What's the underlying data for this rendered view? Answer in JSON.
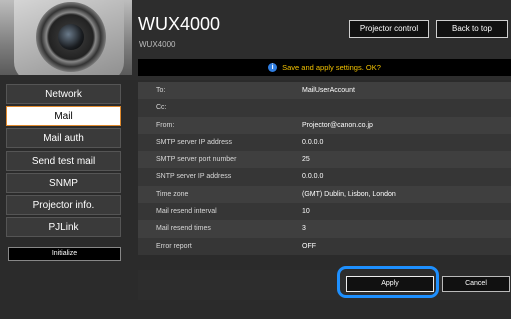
{
  "header": {
    "title": "WUX4000",
    "subtitle": "WUX4000",
    "projector_control_label": "Projector control",
    "back_to_top_label": "Back to top",
    "message": "Save and apply settings. OK?"
  },
  "sidebar": {
    "items": [
      {
        "label": "Network"
      },
      {
        "label": "Mail"
      },
      {
        "label": "Mail auth"
      },
      {
        "label": "Send test mail"
      },
      {
        "label": "SNMP"
      },
      {
        "label": "Projector info."
      },
      {
        "label": "PJLink"
      }
    ],
    "active": "Mail",
    "initialize_label": "Initialize"
  },
  "settings": {
    "rows": [
      {
        "label": "To:",
        "value": "MailUserAccount"
      },
      {
        "label": "Cc:",
        "value": ""
      },
      {
        "label": "From:",
        "value": "Projector@canon.co.jp"
      },
      {
        "label": "SMTP server IP address",
        "value": "0.0.0.0"
      },
      {
        "label": "SMTP server port number",
        "value": "25"
      },
      {
        "label": "SNTP server IP address",
        "value": "0.0.0.0"
      },
      {
        "label": "Time zone",
        "value": "(GMT) Dublin, Lisbon, London"
      },
      {
        "label": "Mail resend interval",
        "value": "10"
      },
      {
        "label": "Mail resend times",
        "value": "3"
      },
      {
        "label": "Error report",
        "value": "OFF"
      }
    ]
  },
  "actions": {
    "apply_label": "Apply",
    "cancel_label": "Cancel"
  },
  "colors": {
    "accent_highlight": "#1e90ff",
    "message_text": "#f2c200",
    "active_border": "#e08a2e"
  }
}
